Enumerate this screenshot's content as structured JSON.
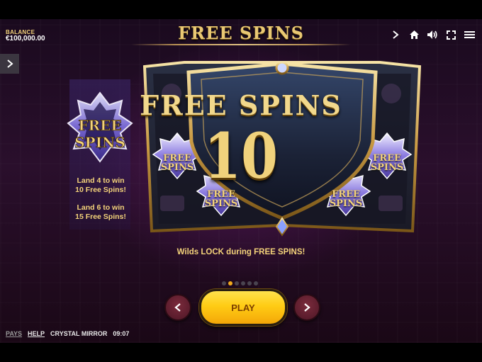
{
  "balance": {
    "label": "BALANCE",
    "value": "€100,000.00"
  },
  "header": {
    "title": "FREE SPINS"
  },
  "top_icons": [
    "chevron-right-icon",
    "home-icon",
    "speaker-icon",
    "fullscreen-icon",
    "menu-icon"
  ],
  "scatter": {
    "symbol_text_line1": "FREE",
    "symbol_text_line2": "SPINS",
    "rule_4": "Land 4 to win 10 Free Spins!",
    "rule_4_line1": "Land 4 to win",
    "rule_4_line2": "10 Free Spins!",
    "rule_6_line1": "Land 6 to win",
    "rule_6_line2": "15 Free Spins!"
  },
  "banner": {
    "heading": "FREE SPINS",
    "count": "10",
    "wild_label_line1": "FREE",
    "wild_label_line2": "SPINS"
  },
  "note": "Wilds LOCK during FREE SPINS!",
  "pagination": {
    "total": 6,
    "active": 2
  },
  "controls": {
    "play_label": "PLAY"
  },
  "footer": {
    "pays": "PAYS",
    "help": "HELP",
    "game": "CRYSTAL MIRROR",
    "time": "09:07"
  },
  "colors": {
    "accent_gold": "#f3d27a",
    "play_yellow": "#ffcc14",
    "nav_red": "#7b2b3c",
    "dot_active": "#f2a91c"
  }
}
